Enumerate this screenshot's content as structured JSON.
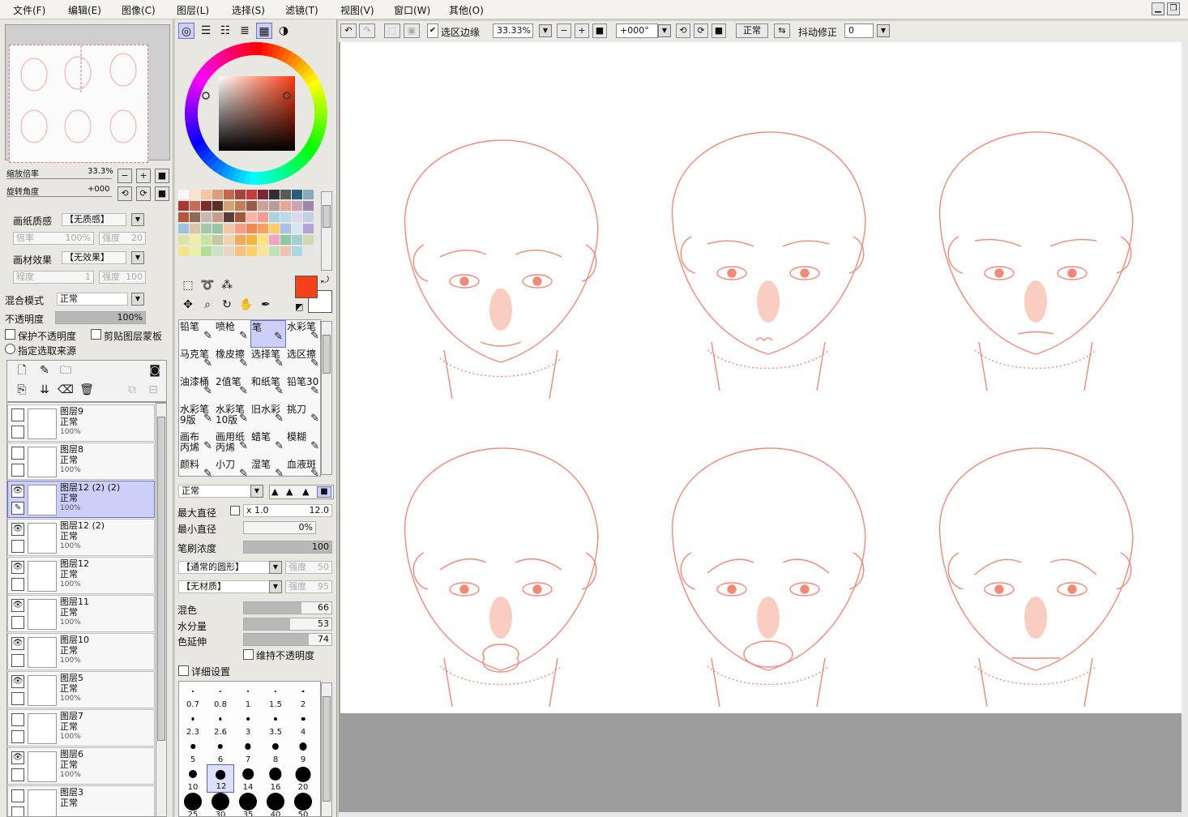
{
  "menu": [
    "文件(F)",
    "编辑(E)",
    "图像(C)",
    "图层(L)",
    "选择(S)",
    "滤镜(T)",
    "视图(V)",
    "窗口(W)",
    "其他(O)"
  ],
  "toolbar": {
    "selection_edge_label": "选区边缘",
    "selection_edge_checked": true,
    "zoom_value": "33.33%",
    "rotation_value": "+000°",
    "blend_mode": "正常",
    "stabilizer_label": "抖动修正",
    "stabilizer_value": "0"
  },
  "navigator": {
    "zoom_label": "缩放倍率",
    "zoom_value": "33.3%",
    "angle_label": "旋转角度",
    "angle_value": "+000"
  },
  "paper": {
    "texture_label": "画纸质感",
    "texture_value": "【无质感】",
    "scale_label": "倍率",
    "scale_value": "100%",
    "strength_label": "强度",
    "strength_value": "20",
    "effect_label": "画材效果",
    "effect_value": "【无效果】",
    "degree_label": "程度",
    "degree_value": "1",
    "effect_strength_label": "强度",
    "effect_strength_value": "100"
  },
  "layer_props": {
    "blend_label": "混合模式",
    "blend_value": "正常",
    "opacity_label": "不透明度",
    "opacity_value": "100%",
    "opacity_level": 1.0,
    "protect_label": "保护不透明度",
    "clip_label": "剪贴图层蒙板",
    "source_label": "指定选取来源"
  },
  "layers": [
    {
      "name": "图层9",
      "blend": "正常",
      "opacity": "100%",
      "visible": false,
      "selected": false
    },
    {
      "name": "图层8",
      "blend": "正常",
      "opacity": "100%",
      "visible": false,
      "selected": false
    },
    {
      "name": "图层12 (2) (2)",
      "blend": "正常",
      "opacity": "100%",
      "visible": true,
      "selected": true
    },
    {
      "name": "图层12 (2)",
      "blend": "正常",
      "opacity": "100%",
      "visible": true,
      "selected": false
    },
    {
      "name": "图层12",
      "blend": "正常",
      "opacity": "100%",
      "visible": true,
      "selected": false
    },
    {
      "name": "图层11",
      "blend": "正常",
      "opacity": "100%",
      "visible": true,
      "selected": false
    },
    {
      "name": "图层10",
      "blend": "正常",
      "opacity": "100%",
      "visible": true,
      "selected": false
    },
    {
      "name": "图层5",
      "blend": "正常",
      "opacity": "100%",
      "visible": true,
      "selected": false
    },
    {
      "name": "图层7",
      "blend": "正常",
      "opacity": "100%",
      "visible": false,
      "selected": false
    },
    {
      "name": "图层6",
      "blend": "正常",
      "opacity": "100%",
      "visible": true,
      "selected": false
    },
    {
      "name": "图层3",
      "blend": "正常",
      "opacity": "",
      "visible": false,
      "selected": false
    }
  ],
  "colors": {
    "primary": "#f5411a",
    "secondary": "#ffffff",
    "sketch_line": "#f08a78",
    "blush": "#f7b9a6",
    "selected_bg": "#ccd0f8"
  },
  "swatches": [
    "#f7f7f7",
    "#fbe3cf",
    "#f4c7a2",
    "#d99f7b",
    "#c2684e",
    "#a6463a",
    "#c83d3a",
    "#7a2730",
    "#2f2f36",
    "#5a5a5a",
    "#2a5f7b",
    "#88a9b9",
    "#a93832",
    "#c56c5c",
    "#7b2e28",
    "#5a2f25",
    "#d4a374",
    "#c17f57",
    "#9b5b49",
    "#caa39a",
    "#b79d98",
    "#e6a799",
    "#cfa3ba",
    "#9b87a7",
    "#b4563e",
    "#8c6b58",
    "#c7b8b1",
    "#c99b8a",
    "#5d3b3a",
    "#a4583a",
    "#f6b4a3",
    "#f39e8e",
    "#a6d3dd",
    "#b8dce7",
    "#dfd7ef",
    "#c2cfe7",
    "#9fc0df",
    "#d8c6a4",
    "#a6c9aa",
    "#99c4a7",
    "#efc7a2",
    "#f59f88",
    "#f2874f",
    "#fb9f61",
    "#f9cd6c",
    "#aac0e0",
    "#d6e5f1",
    "#b2a4d2",
    "#d8e4a6",
    "#f4eaa8",
    "#c7e4a1",
    "#c6c8a0",
    "#edd4ac",
    "#f2a95c",
    "#f7b63b",
    "#ffe37a",
    "#f2a4c3",
    "#8fc9a4",
    "#a0cfcf",
    "#cdd9b5",
    "#f7e18c",
    "#eef0a6",
    "#b0df96",
    "#c5e4c4",
    "#e7d6c4",
    "#f7c07d",
    "#fdd06c",
    "#fae396",
    "#bfe3b4",
    "#f1c1b3",
    "#a9d9e5",
    "#e5e5e5"
  ],
  "brushes": [
    {
      "name": "铅笔",
      "sub": ""
    },
    {
      "name": "喷枪",
      "sub": ""
    },
    {
      "name": "笔",
      "sub": "",
      "selected": true
    },
    {
      "name": "水彩笔",
      "sub": ""
    },
    {
      "name": "马克笔",
      "sub": ""
    },
    {
      "name": "橡皮擦",
      "sub": ""
    },
    {
      "name": "选择笔",
      "sub": ""
    },
    {
      "name": "选区擦",
      "sub": ""
    },
    {
      "name": "油漆桶",
      "sub": ""
    },
    {
      "name": "2值笔",
      "sub": ""
    },
    {
      "name": "和纸笔",
      "sub": ""
    },
    {
      "name": "铅笔30",
      "sub": ""
    },
    {
      "name": "水彩笔",
      "sub": "9版"
    },
    {
      "name": "水彩笔",
      "sub": "10版"
    },
    {
      "name": "旧水彩",
      "sub": ""
    },
    {
      "name": "挑刀",
      "sub": ""
    },
    {
      "name": "画布",
      "sub": "丙烯"
    },
    {
      "name": "画用纸",
      "sub": "丙烯"
    },
    {
      "name": "蜡笔",
      "sub": ""
    },
    {
      "name": "模糊",
      "sub": ""
    },
    {
      "name": "颜料",
      "sub": ""
    },
    {
      "name": "小刀",
      "sub": ""
    },
    {
      "name": "湿笔",
      "sub": ""
    },
    {
      "name": "血液斑",
      "sub": ""
    }
  ],
  "brush_settings": {
    "blend_value": "正常",
    "max_size_label": "最大直径",
    "max_size_mult": "x 1.0",
    "max_size_value": "12.0",
    "min_size_label": "最小直径",
    "min_size_value": "0%",
    "min_size_level": 0,
    "density_label": "笔刷浓度",
    "density_value": "100",
    "density_level": 1.0,
    "shape_value": "【通常的圆形】",
    "shape_strength_label": "强度",
    "shape_strength_value": "50",
    "texture_value": "【无材质】",
    "texture_strength_label": "强度",
    "texture_strength_value": "95",
    "blend_label": "混色",
    "blend_num": "66",
    "blend_level": 0.66,
    "water_label": "水分量",
    "water_num": "53",
    "water_level": 0.53,
    "persist_label": "色延伸",
    "persist_num": "74",
    "persist_level": 0.74,
    "keep_opacity_label": "维持不透明度",
    "advanced_label": "详细设置"
  },
  "sizes": [
    "0.7",
    "0.8",
    "1",
    "1.5",
    "2",
    "2.3",
    "2.6",
    "3",
    "3.5",
    "4",
    "5",
    "6",
    "7",
    "8",
    "9",
    "10",
    "12",
    "14",
    "16",
    "20",
    "25",
    "30",
    "35",
    "40",
    "50"
  ],
  "selected_size": "12"
}
